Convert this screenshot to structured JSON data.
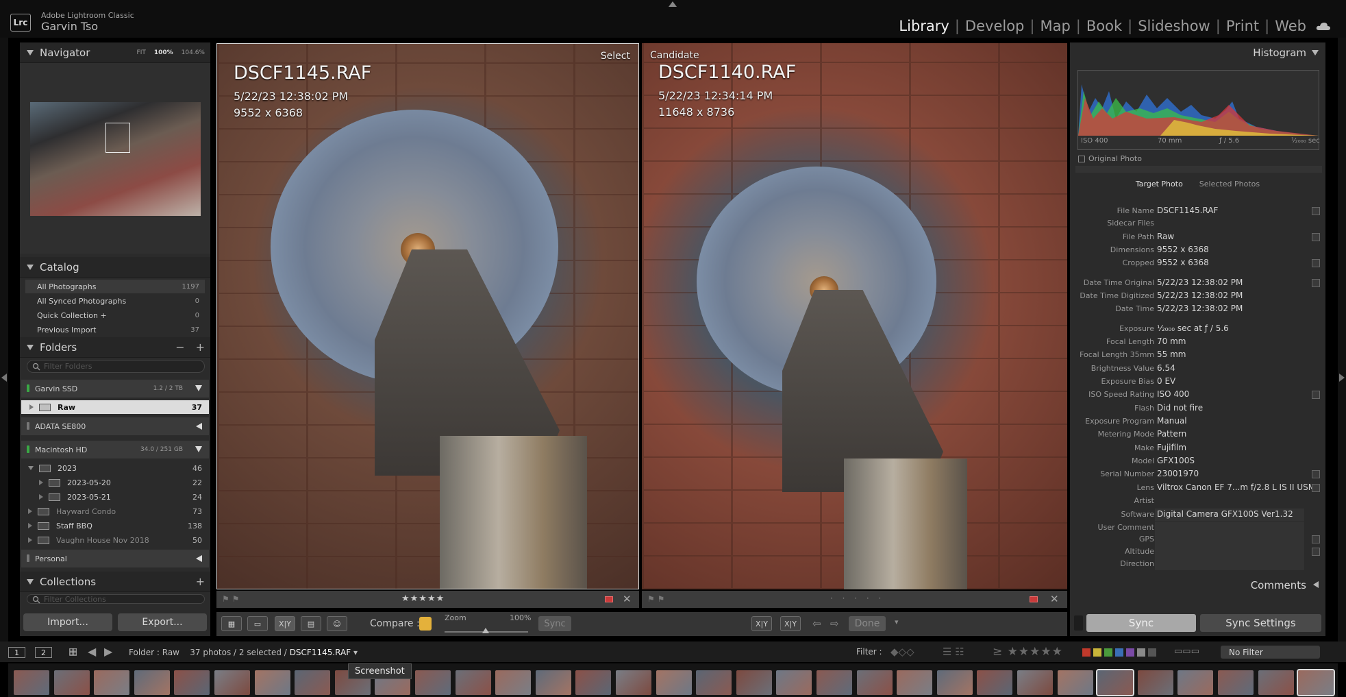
{
  "app": {
    "name": "Adobe Lightroom Classic",
    "logo": "Lrc",
    "user": "Garvin Tso"
  },
  "modules": [
    "Library",
    "Develop",
    "Map",
    "Book",
    "Slideshow",
    "Print",
    "Web"
  ],
  "active_module": "Library",
  "navigator": {
    "title": "Navigator",
    "fit": "FIT",
    "zoom_100": "100%",
    "zoom_custom": "104.6%"
  },
  "catalog": {
    "title": "Catalog",
    "items": [
      {
        "label": "All Photographs",
        "count": "1197"
      },
      {
        "label": "All Synced Photographs",
        "count": "0"
      },
      {
        "label": "Quick Collection +",
        "count": "0"
      },
      {
        "label": "Previous Import",
        "count": "37"
      }
    ]
  },
  "folders": {
    "title": "Folders",
    "filter_placeholder": "Filter Folders",
    "volumes": [
      {
        "name": "Garvin SSD",
        "space": "1.2 / 2 TB"
      },
      {
        "name": "ADATA SE800",
        "space": ""
      },
      {
        "name": "Macintosh HD",
        "space": "34.0 / 251 GB"
      },
      {
        "name": "Personal",
        "space": ""
      }
    ],
    "raw": {
      "name": "Raw",
      "count": "37"
    },
    "mac_items": [
      {
        "name": "2023",
        "count": "46"
      },
      {
        "name": "2023-05-20",
        "count": "22"
      },
      {
        "name": "2023-05-21",
        "count": "24"
      },
      {
        "name": "Hayward Condo",
        "count": "73"
      },
      {
        "name": "Staff BBQ",
        "count": "138"
      },
      {
        "name": "Vaughn House Nov 2018",
        "count": "50"
      }
    ]
  },
  "collections": {
    "title": "Collections",
    "filter_placeholder": "Filter Collections"
  },
  "buttons": {
    "import": "Import...",
    "export": "Export..."
  },
  "select_photo": {
    "tag": "Select",
    "filename": "DSCF1145.RAF",
    "datetime": "5/22/23 12:38:02 PM",
    "dimensions": "9552 x 6368",
    "stars": "★★★★★"
  },
  "candidate_photo": {
    "tag": "Candidate",
    "filename": "DSCF1140.RAF",
    "datetime": "5/22/23 12:34:14 PM",
    "dimensions": "11648 x 8736",
    "stars": "· · · · ·"
  },
  "toolbar": {
    "compare_label": "Compare :",
    "zoom_label": "Zoom",
    "zoom_pct": "100%",
    "sync": "Sync",
    "done": "Done",
    "xy": "X|Y"
  },
  "histogram": {
    "title": "Histogram",
    "iso": "ISO 400",
    "focal": "70 mm",
    "aperture": "ƒ / 5.6",
    "shutter": "¹⁄₂₀₀₀ sec",
    "original_photo": "Original Photo"
  },
  "metadata": {
    "target_tab": "Target Photo",
    "selected_tab": "Selected Photos",
    "rows": [
      {
        "label": "File Name",
        "value": "DSCF1145.RAF"
      },
      {
        "label": "Sidecar Files",
        "value": ""
      },
      {
        "label": "File Path",
        "value": "Raw"
      },
      {
        "label": "Dimensions",
        "value": "9552 x 6368"
      },
      {
        "label": "Cropped",
        "value": "9552 x 6368"
      },
      {
        "label": "Date Time Original",
        "value": "5/22/23 12:38:02 PM"
      },
      {
        "label": "Date Time Digitized",
        "value": "5/22/23 12:38:02 PM"
      },
      {
        "label": "Date Time",
        "value": "5/22/23 12:38:02 PM"
      },
      {
        "label": "Exposure",
        "value": "¹⁄₂₀₀₀ sec at ƒ / 5.6"
      },
      {
        "label": "Focal Length",
        "value": "70 mm"
      },
      {
        "label": "Focal Length 35mm",
        "value": "55 mm"
      },
      {
        "label": "Brightness Value",
        "value": "6.54"
      },
      {
        "label": "Exposure Bias",
        "value": "0 EV"
      },
      {
        "label": "ISO Speed Rating",
        "value": "ISO 400"
      },
      {
        "label": "Flash",
        "value": "Did not fire"
      },
      {
        "label": "Exposure Program",
        "value": "Manual"
      },
      {
        "label": "Metering Mode",
        "value": "Pattern"
      },
      {
        "label": "Make",
        "value": "Fujifilm"
      },
      {
        "label": "Model",
        "value": "GFX100S"
      },
      {
        "label": "Serial Number",
        "value": "23001970"
      },
      {
        "label": "Lens",
        "value": "Viltrox Canon EF 7...m f/2.8 L IS II USM"
      },
      {
        "label": "Artist",
        "value": ""
      },
      {
        "label": "Software",
        "value": "Digital Camera GFX100S Ver1.32"
      },
      {
        "label": "User Comment",
        "value": ""
      },
      {
        "label": "GPS",
        "value": ""
      },
      {
        "label": "Altitude",
        "value": ""
      },
      {
        "label": "Direction",
        "value": ""
      }
    ]
  },
  "comments": {
    "title": "Comments"
  },
  "right_buttons": {
    "sync": "Sync",
    "sync_settings": "Sync Settings"
  },
  "filmstrip": {
    "page1": "1",
    "page2": "2",
    "folder": "Folder : Raw",
    "count": "37 photos / 2 selected /",
    "current": "DSCF1145.RAF",
    "filter_label": "Filter :",
    "stars": "≥ ★★★★★",
    "no_filter": "No Filter",
    "tooltip": "Screenshot",
    "label_colors": [
      "#c0392b",
      "#c9b53a",
      "#4b9b3c",
      "#3a6fb5",
      "#7a4aa6",
      "#8a8a8a",
      "#555555"
    ]
  }
}
